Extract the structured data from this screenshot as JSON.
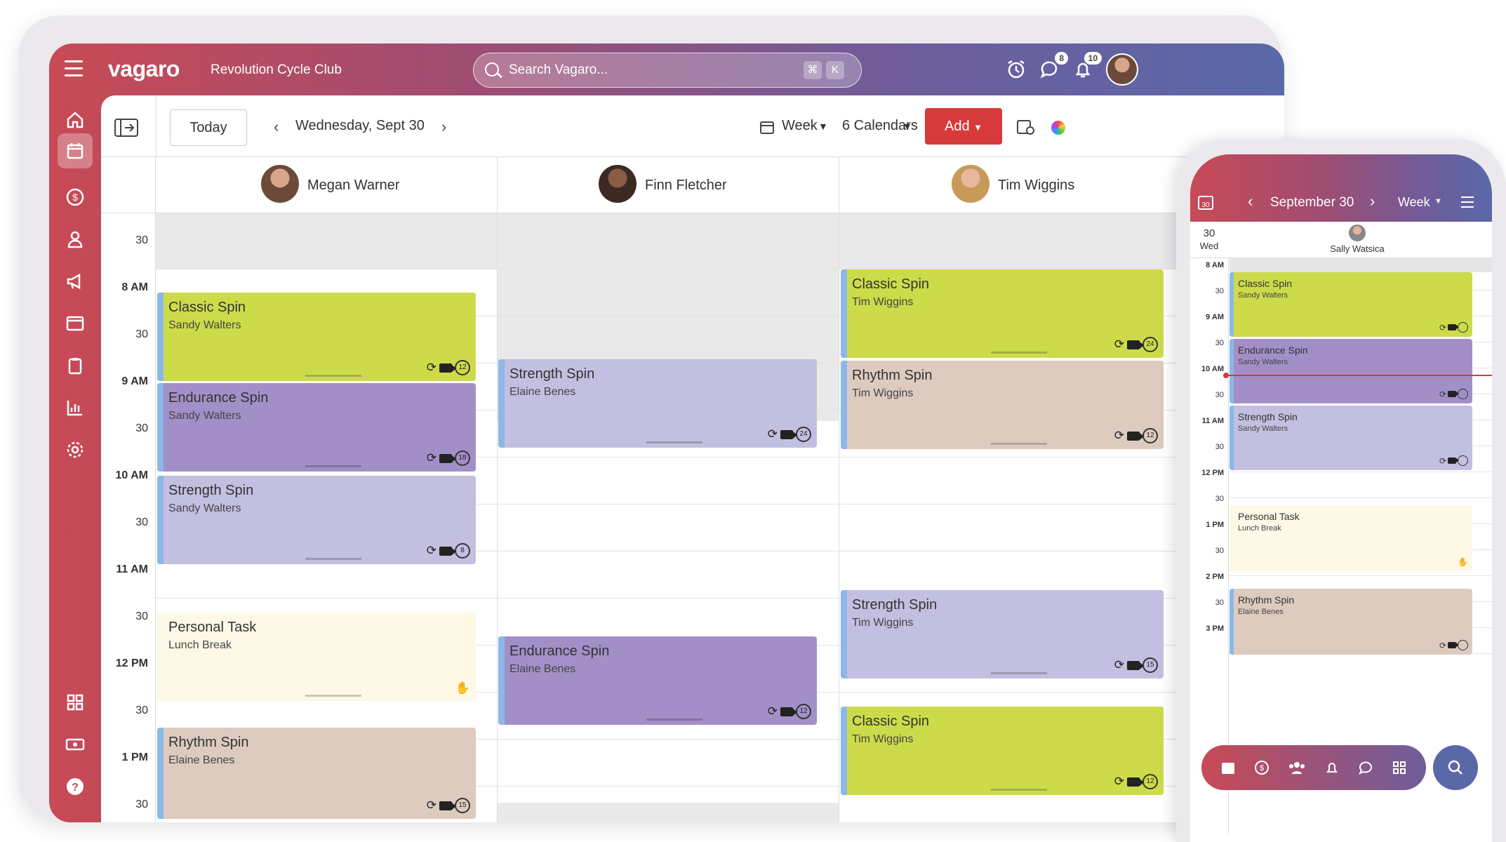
{
  "app": {
    "logo": "vagaro",
    "business": "Revolution Cycle Club"
  },
  "search": {
    "placeholder": "Search Vagaro...",
    "kbd1": "⌘",
    "kbd2": "K"
  },
  "topbar": {
    "messages_badge": "8",
    "notifications_badge": "10"
  },
  "toolbar": {
    "today": "Today",
    "date": "Wednesday, Sept 30",
    "view": "Week",
    "calendars": "6 Calendars",
    "add": "Add"
  },
  "columns": [
    {
      "name": "Megan Warner"
    },
    {
      "name": "Finn Fletcher"
    },
    {
      "name": "Tim Wiggins"
    }
  ],
  "times": [
    "30",
    "8 AM",
    "30",
    "9 AM",
    "30",
    "10 AM",
    "30",
    "11 AM",
    "30",
    "12 PM",
    "30",
    "1 PM",
    "30"
  ],
  "events": [
    {
      "col": 0,
      "title": "Classic Spin",
      "sub": "Sandy Walters",
      "color": "green",
      "count": "12"
    },
    {
      "col": 0,
      "title": "Endurance Spin",
      "sub": "Sandy Walters",
      "color": "purple",
      "count": "18"
    },
    {
      "col": 0,
      "title": "Strength Spin",
      "sub": "Sandy Walters",
      "color": "lav",
      "count": "8"
    },
    {
      "col": 0,
      "title": "Personal Task",
      "sub": "Lunch Break",
      "color": "cream",
      "count": ""
    },
    {
      "col": 0,
      "title": "Rhythm Spin",
      "sub": "Elaine Benes",
      "color": "tan",
      "count": "15"
    },
    {
      "col": 1,
      "title": "Strength Spin",
      "sub": "Elaine Benes",
      "color": "lav",
      "count": "24"
    },
    {
      "col": 1,
      "title": "Endurance Spin",
      "sub": "Elaine Benes",
      "color": "purple",
      "count": "12"
    },
    {
      "col": 2,
      "title": "Classic Spin",
      "sub": "Tim Wiggins",
      "color": "green",
      "count": "24"
    },
    {
      "col": 2,
      "title": "Rhythm Spin",
      "sub": "Tim Wiggins",
      "color": "tan",
      "count": "12"
    },
    {
      "col": 2,
      "title": "Strength Spin",
      "sub": "Tim Wiggins",
      "color": "lav",
      "count": "15"
    },
    {
      "col": 2,
      "title": "Classic Spin",
      "sub": "Tim Wiggins",
      "color": "green",
      "count": "12"
    }
  ],
  "phone": {
    "date_title": "September 30",
    "view": "Week",
    "day_num": "30",
    "day_name": "Wed",
    "staff": "Sally Watsica",
    "times": [
      "8 AM",
      "30",
      "9 AM",
      "30",
      "10 AM",
      "30",
      "11 AM",
      "30",
      "12 PM",
      "30",
      "1 PM",
      "30",
      "2 PM",
      "30",
      "3 PM"
    ],
    "events": [
      {
        "title": "Classic Spin",
        "sub": "Sandy Walters",
        "color": "green"
      },
      {
        "title": "Endurance Spin",
        "sub": "Sandy Walters",
        "color": "purple"
      },
      {
        "title": "Strength Spin",
        "sub": "Sandy Walters",
        "color": "lav"
      },
      {
        "title": "Personal Task",
        "sub": "Lunch Break",
        "color": "cream"
      },
      {
        "title": "Rhythm Spin",
        "sub": "Elaine Benes",
        "color": "tan"
      }
    ]
  }
}
